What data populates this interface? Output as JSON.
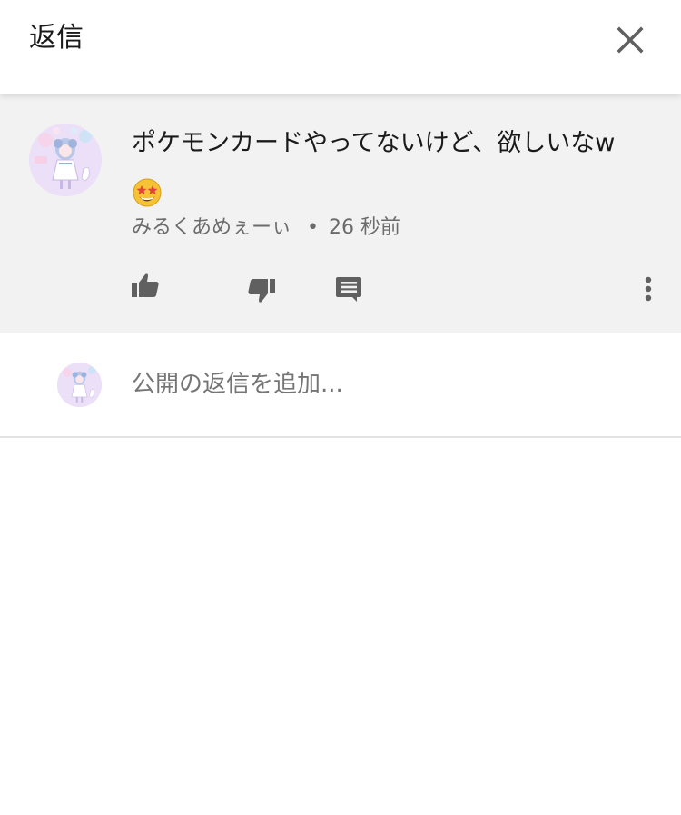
{
  "header": {
    "title": "返信",
    "close_icon": "close-icon"
  },
  "comment": {
    "avatar_icon": "user-avatar",
    "text": "ポケモンカードやってないけど、欲しいなw",
    "emoji": "star-struck-emoji",
    "author": "みるくあめぇーぃ",
    "separator": "•",
    "time": "26 秒前",
    "actions": {
      "like_icon": "thumbs-up-icon",
      "dislike_icon": "thumbs-down-icon",
      "reply_icon": "comment-icon",
      "more_icon": "more-vertical-icon"
    }
  },
  "reply_box": {
    "placeholder": "公開の返信を追加..."
  },
  "colors": {
    "comment_background": "#f2f2f2",
    "icon": "#606060",
    "secondary_text": "#6b6b6b",
    "avatar_background": "#e9dcf7"
  }
}
